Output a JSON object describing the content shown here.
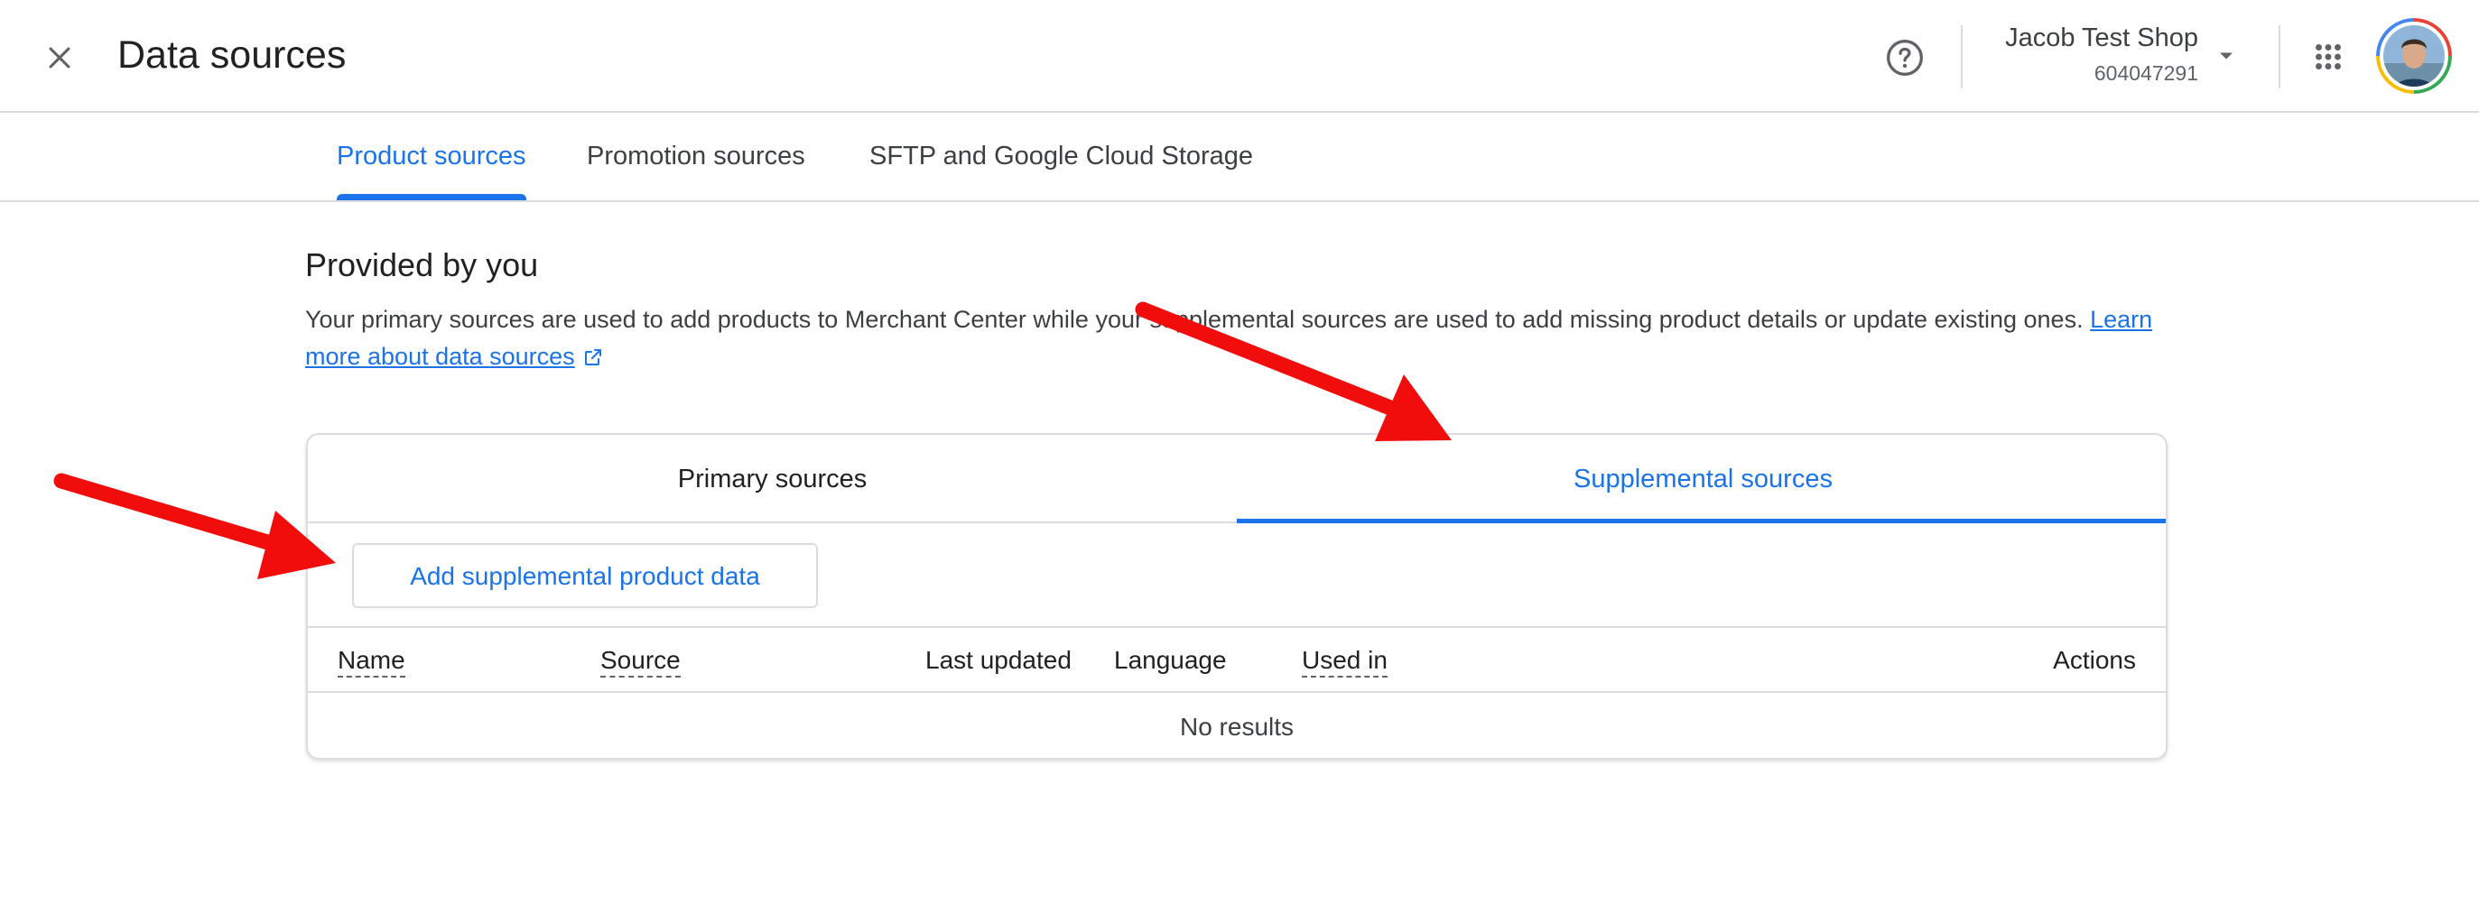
{
  "header": {
    "title": "Data sources",
    "account_name": "Jacob Test Shop",
    "account_id": "604047291"
  },
  "tabs": [
    {
      "label": "Product sources",
      "active": true
    },
    {
      "label": "Promotion sources",
      "active": false
    },
    {
      "label": "SFTP and Google Cloud Storage",
      "active": false
    }
  ],
  "section": {
    "heading": "Provided by you",
    "description": "Your primary sources are used to add products to Merchant Center while your supplemental sources are used to add missing product details or update existing ones.",
    "learn_more": "Learn more about data sources"
  },
  "card": {
    "tabs": [
      {
        "label": "Primary sources",
        "active": false
      },
      {
        "label": "Supplemental sources",
        "active": true
      }
    ],
    "add_button": "Add supplemental product data",
    "columns": [
      "Name",
      "Source",
      "Last updated",
      "Language",
      "Used in",
      "Actions"
    ],
    "empty_text": "No results"
  },
  "colors": {
    "accent": "#1a73e8",
    "annotation_arrow": "#f20d0d"
  },
  "icons": [
    "close-icon",
    "help-icon",
    "caret-down-icon",
    "apps-grid-icon",
    "avatar",
    "external-link-icon"
  ]
}
